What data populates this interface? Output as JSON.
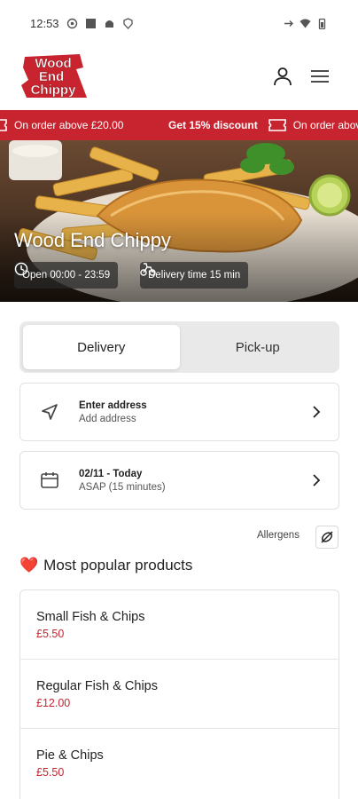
{
  "status_bar": {
    "time": "12:53"
  },
  "brand": {
    "logo_lines": [
      "Wood",
      "End",
      "Chippy"
    ],
    "accent": "#c8242f"
  },
  "promo": {
    "items": [
      {
        "prefix": "",
        "text": "On order above £20.00"
      },
      {
        "prefix": "Get 15% discount",
        "text": "On order above"
      }
    ]
  },
  "hero": {
    "title": "Wood End Chippy",
    "open_hours": "Open 00:00 - 23:59",
    "delivery_time": "Delivery time 15 min"
  },
  "tabs": [
    {
      "label": "Delivery",
      "active": true
    },
    {
      "label": "Pick-up",
      "active": false
    }
  ],
  "address": {
    "title": "Enter address",
    "subtitle": "Add address"
  },
  "schedule": {
    "title": "02/11 - Today",
    "subtitle": "ASAP (15 minutes)"
  },
  "allergens_label": "Allergens",
  "section": {
    "emoji": "❤️",
    "title": "Most popular products"
  },
  "products": [
    {
      "name": "Small Fish & Chips",
      "price": "£5.50"
    },
    {
      "name": "Regular Fish & Chips",
      "price": "£12.00"
    },
    {
      "name": "Pie & Chips",
      "price": "£5.50"
    }
  ]
}
